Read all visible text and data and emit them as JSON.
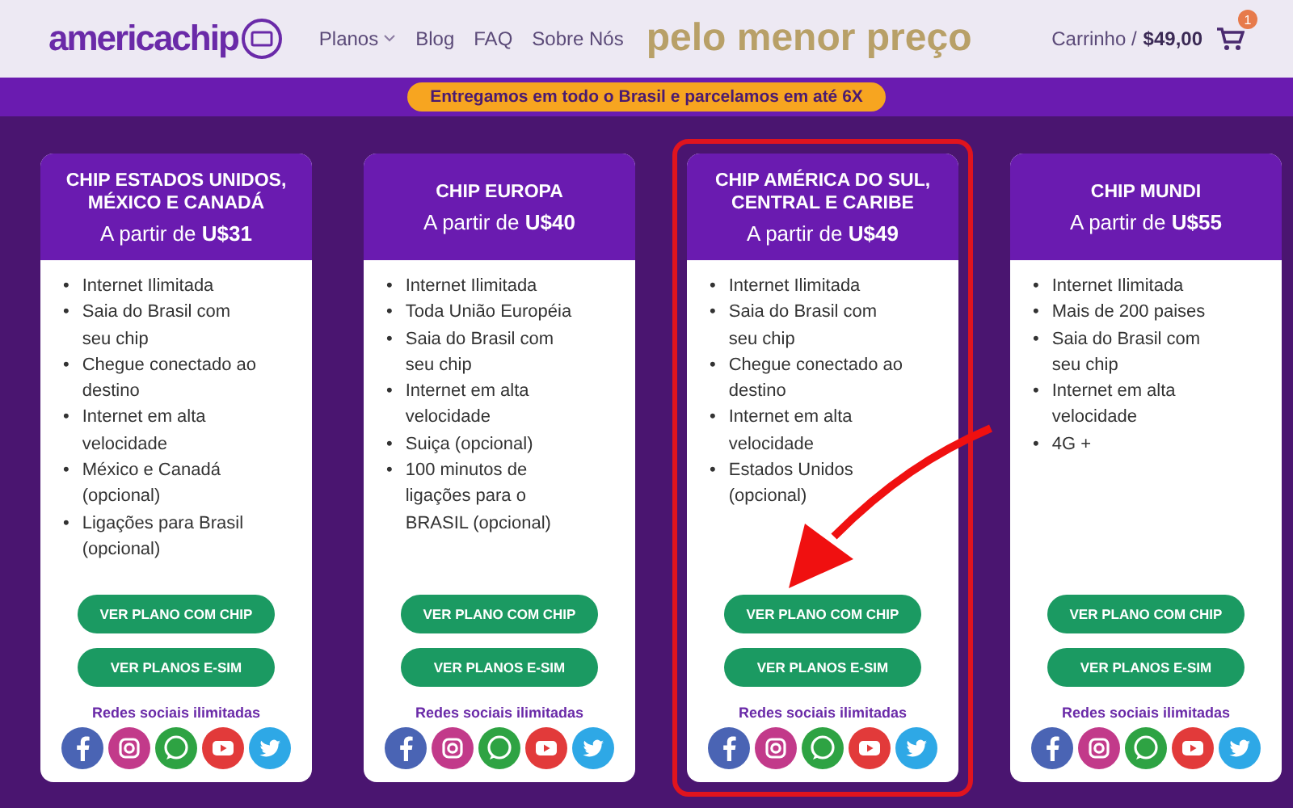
{
  "header": {
    "logo": "americachip",
    "nav": [
      {
        "label": "Planos",
        "dropdown": true
      },
      {
        "label": "Blog",
        "dropdown": false
      },
      {
        "label": "FAQ",
        "dropdown": false
      },
      {
        "label": "Sobre Nós",
        "dropdown": false
      }
    ],
    "hero_text": "pelo menor preço",
    "cart_label": "Carrinho /",
    "cart_total": "$49,00",
    "cart_count": "1"
  },
  "bullet": "•",
  "banner": "Entregamos em todo o Brasil e parcelamos em até 6X",
  "plans": [
    {
      "title": "CHIP ESTADOS UNIDOS, MÉXICO E CANADÁ",
      "price": "A partir de **U$31**",
      "highlighted": false,
      "features": [
        "Internet Ilimitada",
        "Saia do Brasil com seu chip",
        "Chegue conectado ao destino",
        "Internet em alta velocidade",
        "México e Canadá (opcional)",
        "Ligações para Brasil (opcional)"
      ],
      "buttons": [
        "VER PLANO COM CHIP",
        "VER PLANOS E-SIM"
      ],
      "social_label": "Redes sociais ilimitadas"
    },
    {
      "title": "CHIP EUROPA",
      "price": "A partir de **U$40**",
      "highlighted": false,
      "features": [
        "Internet Ilimitada",
        "Toda União Européia",
        "Saia do Brasil com seu chip",
        "Internet em alta velocidade",
        "Suiça (opcional)",
        "100 minutos de ligações para o BRASIL (opcional)"
      ],
      "buttons": [
        "VER PLANO COM CHIP",
        "VER PLANOS E-SIM"
      ],
      "social_label": "Redes sociais ilimitadas"
    },
    {
      "title": "CHIP AMÉRICA DO SUL, CENTRAL E CARIBE",
      "price": "A partir de **U$49**",
      "highlighted": true,
      "features": [
        "Internet Ilimitada",
        "Saia do Brasil com seu chip",
        "Chegue conectado ao destino",
        "Internet em alta velocidade",
        "Estados Unidos (opcional)"
      ],
      "buttons": [
        "VER PLANO COM CHIP",
        "VER PLANOS E-SIM"
      ],
      "social_label": "Redes sociais ilimitadas"
    },
    {
      "title": "CHIP MUNDI",
      "price": "A partir de **U$55**",
      "highlighted": false,
      "features": [
        "Internet Ilimitada",
        "Mais de 200 paises",
        "Saia do Brasil com seu chip",
        "Internet em alta velocidade",
        "4G +"
      ],
      "buttons": [
        "VER PLANO COM CHIP",
        "VER PLANOS E-SIM"
      ],
      "social_label": "Redes sociais ilimitadas"
    }
  ]
}
